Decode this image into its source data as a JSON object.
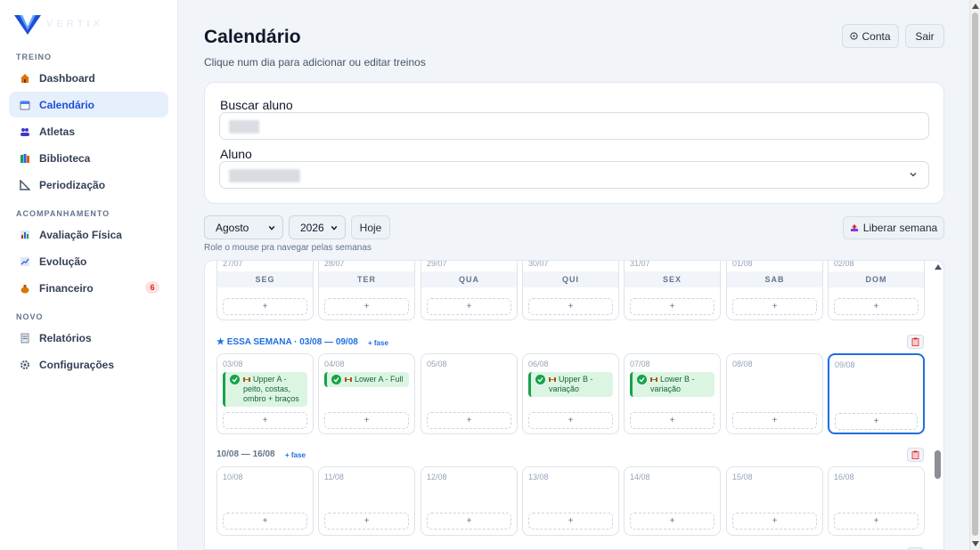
{
  "brand": {
    "name": "VERTIX"
  },
  "sidebar": {
    "sections": [
      {
        "label": "TREINO"
      },
      {
        "label": "ACOMPANHAMENTO"
      },
      {
        "label": "NOVO"
      }
    ],
    "items": [
      {
        "label": "Dashboard",
        "icon": "house-icon",
        "active": false
      },
      {
        "label": "Calendário",
        "icon": "calendar-icon",
        "active": true
      },
      {
        "label": "Atletas",
        "icon": "people-icon",
        "active": false
      },
      {
        "label": "Biblioteca",
        "icon": "books-icon",
        "active": false
      },
      {
        "label": "Periodização",
        "icon": "triangle-ruler-icon",
        "active": false
      },
      {
        "label": "Avaliação Física",
        "icon": "bar-chart-icon",
        "active": false
      },
      {
        "label": "Evolução",
        "icon": "trend-chart-icon",
        "active": false
      },
      {
        "label": "Financeiro",
        "icon": "money-bag-icon",
        "active": false,
        "badge": "6"
      },
      {
        "label": "Relatórios",
        "icon": "report-icon",
        "active": false
      },
      {
        "label": "Configurações",
        "icon": "gear-icon",
        "active": false
      }
    ]
  },
  "header": {
    "title": "Calendário",
    "subtitle": "Clique num dia para adicionar ou editar treinos",
    "account_label": "Conta",
    "account_icon": "user-circle-icon",
    "logout_label": "Sair"
  },
  "search": {
    "search_label": "Buscar aluno",
    "student_label": "Aluno"
  },
  "controls": {
    "month": "Agosto",
    "year": "2026",
    "today_label": "Hoje",
    "release_label": "Liberar semana",
    "release_icon": "upload-icon",
    "hint": "Role o mouse pra navegar pelas semanas"
  },
  "calendar": {
    "day_names": [
      "SEG",
      "TER",
      "QUA",
      "QUI",
      "SEX",
      "SAB",
      "DOM"
    ],
    "add_label": "+",
    "prev_week_dates": [
      "27/07",
      "28/07",
      "29/07",
      "30/07",
      "31/07",
      "01/08",
      "02/08"
    ],
    "current_week": {
      "title": "★ ESSA SEMANA · 03/08 — 09/08",
      "fase_label": "+ fase",
      "dates": [
        "03/08",
        "04/08",
        "05/08",
        "06/08",
        "07/08",
        "08/08",
        "09/08"
      ],
      "workouts": [
        {
          "day": 0,
          "text": "Upper A - peito, costas, ombro + braços"
        },
        {
          "day": 1,
          "text": "Lower A - Full"
        },
        {
          "day": 3,
          "text": "Upper B - variação"
        },
        {
          "day": 4,
          "text": "Lower B - variação"
        }
      ],
      "selected_day": 6
    },
    "next_week": {
      "title": "10/08 — 16/08",
      "fase_label": "+ fase",
      "dates": [
        "10/08",
        "11/08",
        "12/08",
        "13/08",
        "14/08",
        "15/08",
        "16/08"
      ]
    }
  },
  "colors": {
    "accent": "#1d4ed8",
    "success": "#16a34a",
    "workout_bg": "#dcf5e3",
    "danger": "#dc2626"
  }
}
